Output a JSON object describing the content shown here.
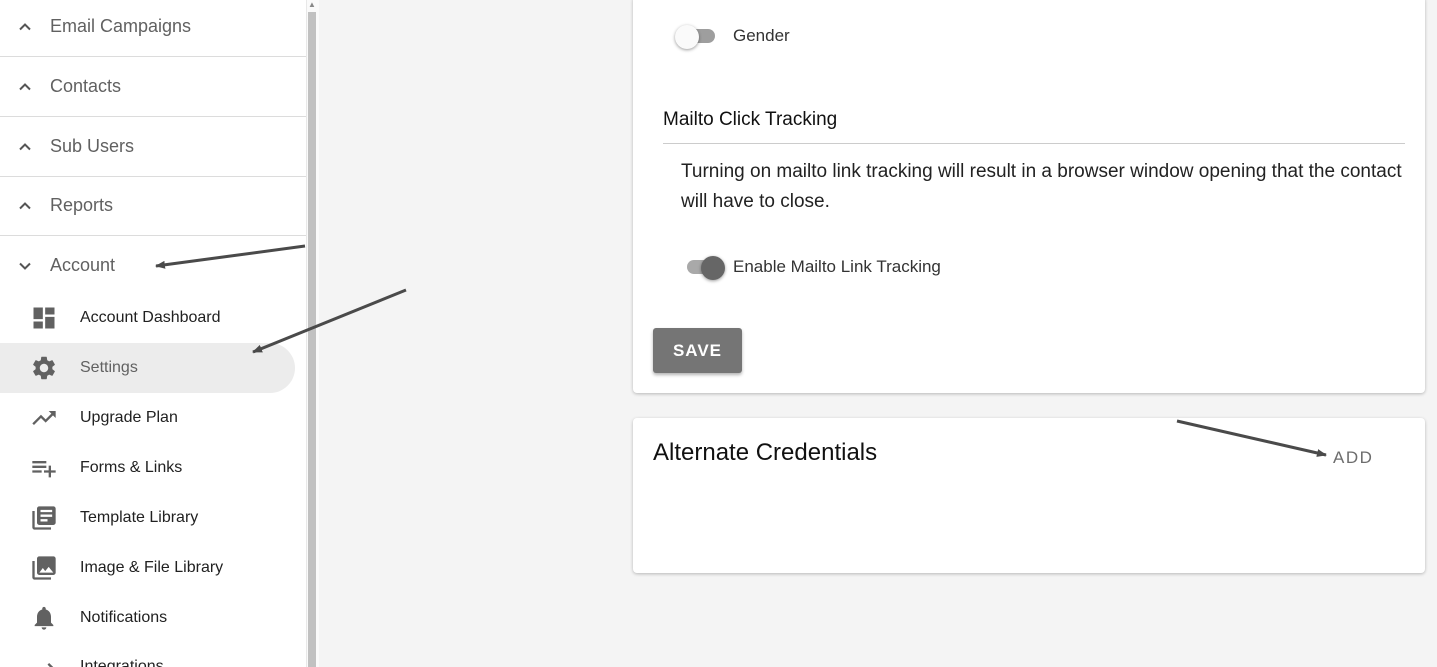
{
  "sidebar": {
    "sections": [
      {
        "label": "Email Campaigns",
        "expanded": false
      },
      {
        "label": "Contacts",
        "expanded": false
      },
      {
        "label": "Sub Users",
        "expanded": false
      },
      {
        "label": "Reports",
        "expanded": false
      },
      {
        "label": "Account",
        "expanded": true
      }
    ],
    "account_items": [
      {
        "label": "Account Dashboard",
        "icon": "dashboard-icon"
      },
      {
        "label": "Settings",
        "icon": "gear-icon",
        "active": true
      },
      {
        "label": "Upgrade Plan",
        "icon": "trending-up-icon"
      },
      {
        "label": "Forms & Links",
        "icon": "playlist-add-icon"
      },
      {
        "label": "Template Library",
        "icon": "library-books-icon"
      },
      {
        "label": "Image & File Library",
        "icon": "photo-library-icon"
      },
      {
        "label": "Notifications",
        "icon": "bell-icon"
      },
      {
        "label": "Integrations",
        "icon": "arrows-icon"
      }
    ]
  },
  "settings_card": {
    "gender_toggle": {
      "label": "Gender",
      "on": false
    },
    "mailto_section": {
      "title": "Mailto Click Tracking",
      "description": "Turning on mailto link tracking will result in a browser window opening that the contact will have to close.",
      "toggle": {
        "label": "Enable Mailto Link Tracking",
        "on": true
      }
    },
    "save_label": "SAVE"
  },
  "alternate_credentials_card": {
    "title": "Alternate Credentials",
    "add_label": "ADD"
  },
  "colors": {
    "accent_gray": "#757575",
    "annotation_arrow": "#4a4a4a"
  }
}
